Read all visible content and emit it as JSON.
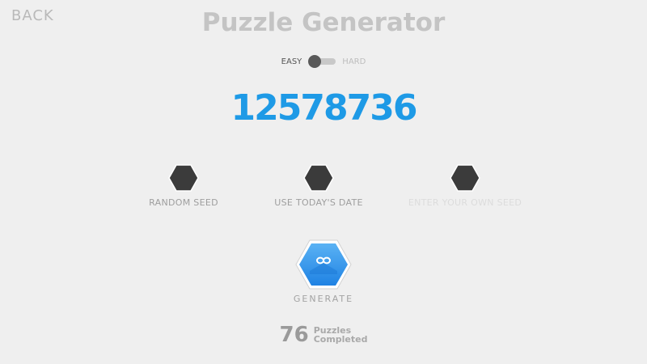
{
  "nav": {
    "back_label": "BACK"
  },
  "title": "Puzzle Generator",
  "difficulty": {
    "easy_label": "EASY",
    "hard_label": "HARD",
    "selected": "EASY"
  },
  "seed": "12578736",
  "seed_options": [
    {
      "label": "RANDOM SEED"
    },
    {
      "label": "USE TODAY'S DATE"
    },
    {
      "label": "ENTER YOUR OWN SEED"
    }
  ],
  "generate": {
    "label": "GENERATE"
  },
  "stats": {
    "count": "76",
    "line1": "Puzzles",
    "line2": "Completed"
  },
  "colors": {
    "accent": "#1e9ae6",
    "hex_dark": "#3b3b3b",
    "background": "#efefef"
  }
}
